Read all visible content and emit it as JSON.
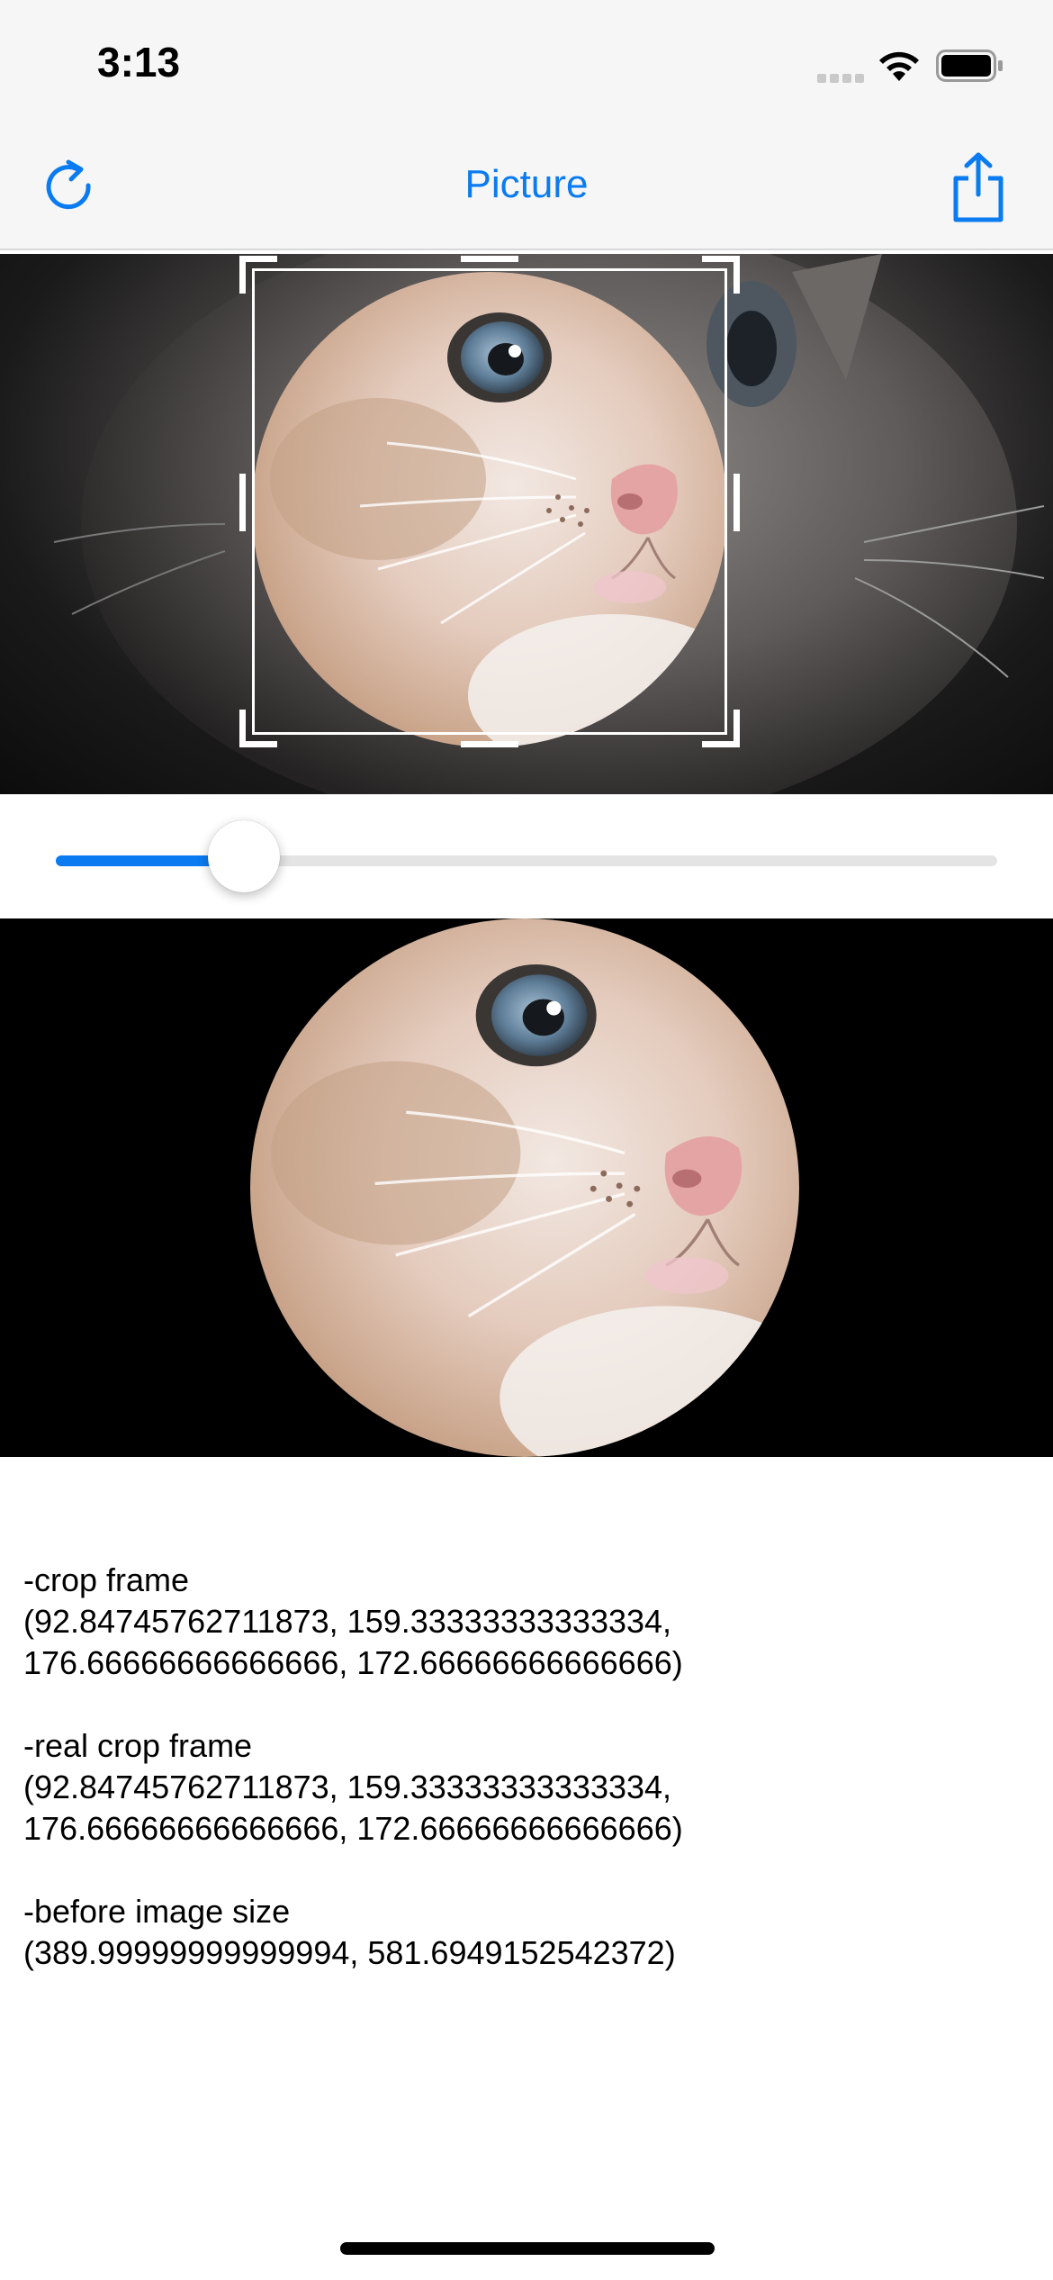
{
  "status_bar": {
    "time": "3:13",
    "icons": [
      "signal-icon",
      "wifi-icon",
      "battery-icon"
    ]
  },
  "nav": {
    "title": "Picture",
    "left_icon": "rotate-icon",
    "right_icon": "share-icon",
    "accent_color": "#0a7bf0"
  },
  "editor": {
    "image": "cat-photo",
    "crop_shape": "circle"
  },
  "slider": {
    "value_fraction": 0.2
  },
  "info": {
    "crop_frame_label": "-crop frame",
    "crop_frame_line1": "(92.84745762711873, 159.33333333333334,",
    "crop_frame_line2": "176.66666666666666, 172.66666666666666)",
    "real_crop_frame_label": "-real crop frame",
    "real_crop_frame_line1": "(92.84745762711873, 159.33333333333334,",
    "real_crop_frame_line2": "176.66666666666666, 172.66666666666666)",
    "before_image_size_label": "-before image size",
    "before_image_size_value": "(389.99999999999994, 581.6949152542372)"
  }
}
